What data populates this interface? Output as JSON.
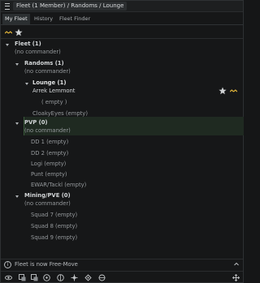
{
  "window": {
    "title": "Fleet (1 Member) / Randoms / Lounge"
  },
  "tabs": [
    {
      "label": "My Fleet",
      "active": true
    },
    {
      "label": "History",
      "active": false
    },
    {
      "label": "Fleet Finder",
      "active": false
    }
  ],
  "toolbar": {
    "icons": [
      "yellow-chevrons-icon",
      "star-icon"
    ]
  },
  "tree": {
    "fleet": {
      "name": "Fleet (1)",
      "commander": "(no commander)"
    },
    "randoms": {
      "name": "Randoms (1)",
      "commander": "(no commander)"
    },
    "lounge": {
      "name": "Lounge (1)",
      "member": "Arrek Lemmont",
      "empty": "( empty )"
    },
    "cloaky": {
      "name": "CloakyEyes (empty)"
    },
    "pvp": {
      "name": "PVP (0)",
      "commander": "(no commander)"
    },
    "pvp_squads": [
      "DD 1 (empty)",
      "DD 2 (empty)",
      "Logi (empty)",
      "Punt (empty)",
      "EWAR/Tackl (empty)"
    ],
    "mining": {
      "name": "Mining/PVE (0)",
      "commander": "(no commander)"
    },
    "mining_squads": [
      "Squad 7 (empty)",
      "Squad 8 (empty)",
      "Squad 9 (empty)"
    ]
  },
  "status": {
    "text": "Fleet is now Free-Move"
  },
  "colors": {
    "accent_yellow": "#e0b43a",
    "highlight_bg": "#1f2a21"
  }
}
